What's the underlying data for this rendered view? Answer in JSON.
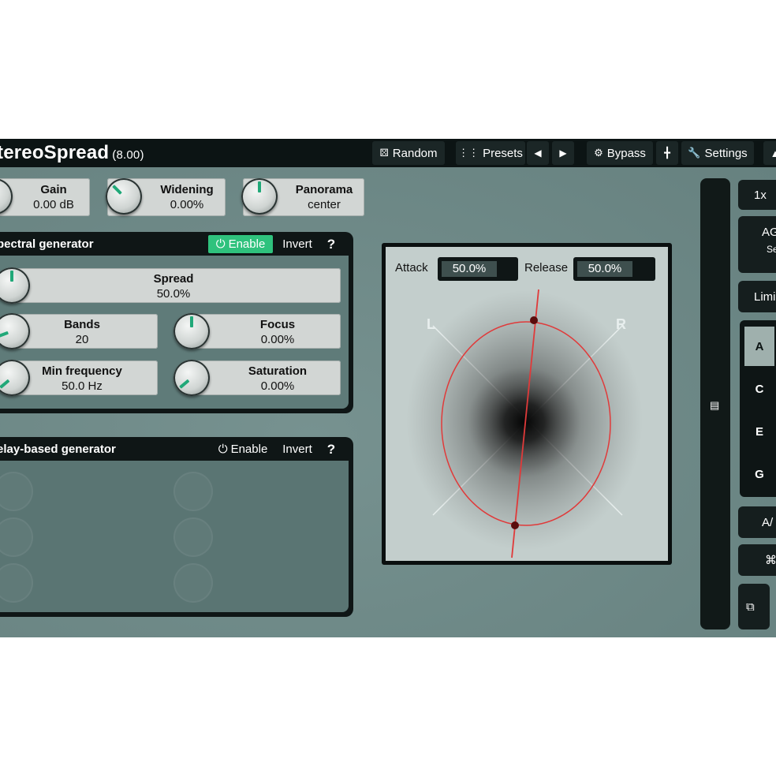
{
  "app": {
    "title": "StereoSpread",
    "title_visible": "tereoSpread",
    "version": "(8.00)"
  },
  "toolbar": {
    "random": "Random",
    "presets": "Presets",
    "prev": "◀",
    "next": "▶",
    "bypass": "Bypass",
    "settings": "Settings"
  },
  "main_controls": [
    {
      "label": "Gain",
      "value": "0.00 dB"
    },
    {
      "label": "Widening",
      "value": "0.00%"
    },
    {
      "label": "Panorama",
      "value": "center"
    }
  ],
  "spectral": {
    "title": "pectral generator",
    "enable": "Enable",
    "invert": "Invert",
    "help": "?",
    "spread": {
      "label": "Spread",
      "value": "50.0%"
    },
    "bands": {
      "label": "Bands",
      "value": "20"
    },
    "focus": {
      "label": "Focus",
      "value": "0.00%"
    },
    "min_frequency": {
      "label": "Min frequency",
      "value": "50.0 Hz"
    },
    "saturation": {
      "label": "Saturation",
      "value": "0.00%"
    }
  },
  "delay": {
    "title": "elay-based generator",
    "enable": "Enable",
    "invert": "Invert",
    "help": "?"
  },
  "scope": {
    "attack_label": "Attack",
    "attack_value": "50.0%",
    "release_label": "Release",
    "release_value": "50.0%",
    "left": "L",
    "right": "R"
  },
  "right_panel": {
    "zoom": "1x",
    "agc": "AG",
    "agc_sub": "Se",
    "limiter": "Limi",
    "slots": [
      "A",
      "C",
      "E",
      "G"
    ],
    "selected_slot": "A",
    "ab": "A/"
  },
  "colors": {
    "accent": "#2fc27d",
    "background": "#6e8b89",
    "scope_curve": "#e03a3a",
    "dark": "#0f1616"
  }
}
